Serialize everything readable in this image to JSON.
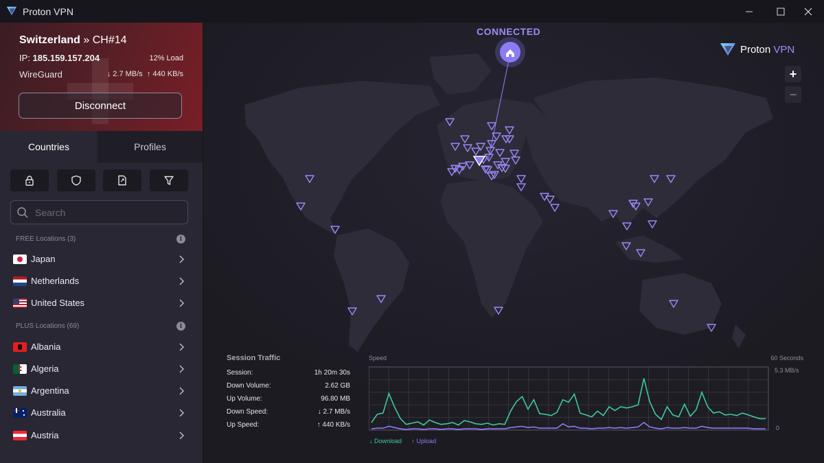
{
  "window": {
    "title": "Proton VPN",
    "minimize_icon": "minimize-icon",
    "maximize_icon": "maximize-icon",
    "close_icon": "close-icon"
  },
  "connection": {
    "country": "Switzerland",
    "separator": "»",
    "server": "CH#14",
    "ip_label": "IP:",
    "ip": "185.159.157.204",
    "load": "12% Load",
    "protocol": "WireGuard",
    "down_speed": "2.7 MB/s",
    "up_speed": "440 KB/s",
    "disconnect_label": "Disconnect"
  },
  "tabs": [
    {
      "label": "Countries",
      "active": true
    },
    {
      "label": "Profiles",
      "active": false
    }
  ],
  "filters": [
    {
      "icon": "lock-icon"
    },
    {
      "icon": "shield-icon"
    },
    {
      "icon": "document-p2p-icon"
    },
    {
      "icon": "filter-icon"
    }
  ],
  "search": {
    "placeholder": "Search"
  },
  "free_section": {
    "label": "FREE Locations (3)",
    "items": [
      {
        "name": "Japan",
        "flag": "jp"
      },
      {
        "name": "Netherlands",
        "flag": "nl"
      },
      {
        "name": "United States",
        "flag": "us"
      }
    ]
  },
  "plus_section": {
    "label": "PLUS Locations (69)",
    "items": [
      {
        "name": "Albania",
        "flag": "al"
      },
      {
        "name": "Algeria",
        "flag": "dz"
      },
      {
        "name": "Argentina",
        "flag": "ar"
      },
      {
        "name": "Australia",
        "flag": "au"
      },
      {
        "name": "Austria",
        "flag": "at"
      }
    ]
  },
  "map": {
    "status": "CONNECTED",
    "brand_first": "Proton",
    "brand_second": "VPN",
    "zoom_in": "+",
    "zoom_out": "−",
    "accent": "#8b7cf6"
  },
  "traffic": {
    "title": "Session Traffic",
    "rows": [
      {
        "label": "Session:",
        "value": "1h 20m 30s"
      },
      {
        "label": "Down Volume:",
        "value": "2.62 GB"
      },
      {
        "label": "Up Volume:",
        "value": "96.80 MB"
      },
      {
        "label": "Down Speed:",
        "value": "↓  2.7 MB/s"
      },
      {
        "label": "Up Speed:",
        "value": "↑  440 KB/s"
      }
    ]
  },
  "graph": {
    "speed_label": "Speed",
    "window_label": "60 Seconds",
    "max_label": "5.3 MB/s",
    "zero_label": "0",
    "download_legend": "↓ Download",
    "upload_legend": "↑ Upload",
    "download_color": "#3ec9a0",
    "upload_color": "#8b7cf6",
    "download": [
      0.12,
      0.25,
      0.27,
      0.58,
      0.36,
      0.18,
      0.09,
      0.11,
      0.13,
      0.08,
      0.16,
      0.12,
      0.09,
      0.1,
      0.12,
      0.08,
      0.15,
      0.13,
      0.1,
      0.09,
      0.11,
      0.08,
      0.1,
      0.09,
      0.3,
      0.45,
      0.53,
      0.33,
      0.48,
      0.26,
      0.25,
      0.23,
      0.28,
      0.48,
      0.44,
      0.57,
      0.27,
      0.24,
      0.21,
      0.3,
      0.23,
      0.37,
      0.31,
      0.37,
      0.35,
      0.37,
      0.4,
      0.82,
      0.45,
      0.25,
      0.17,
      0.37,
      0.24,
      0.21,
      0.41,
      0.22,
      0.32,
      0.6,
      0.37,
      0.27,
      0.29,
      0.24,
      0.25,
      0.23,
      0.27,
      0.24,
      0.21,
      0.18,
      0.18
    ],
    "upload": [
      0.02,
      0.03,
      0.03,
      0.06,
      0.04,
      0.02,
      0.01,
      0.02,
      0.02,
      0.01,
      0.02,
      0.02,
      0.01,
      0.02,
      0.02,
      0.01,
      0.02,
      0.02,
      0.02,
      0.01,
      0.02,
      0.02,
      0.02,
      0.02,
      0.04,
      0.05,
      0.06,
      0.04,
      0.05,
      0.03,
      0.03,
      0.03,
      0.03,
      0.1,
      0.05,
      0.06,
      0.03,
      0.03,
      0.02,
      0.03,
      0.03,
      0.04,
      0.03,
      0.04,
      0.03,
      0.04,
      0.05,
      0.12,
      0.05,
      0.03,
      0.02,
      0.04,
      0.03,
      0.03,
      0.04,
      0.03,
      0.03,
      0.06,
      0.04,
      0.03,
      0.03,
      0.03,
      0.03,
      0.03,
      0.03,
      0.03,
      0.02,
      0.02,
      0.02
    ]
  }
}
